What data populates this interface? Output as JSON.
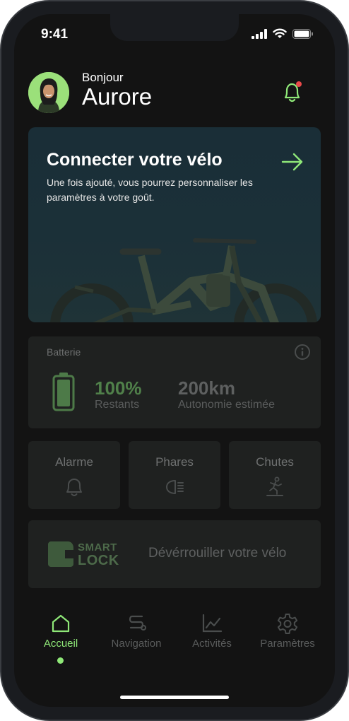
{
  "status_bar": {
    "time": "9:41"
  },
  "header": {
    "greeting": "Bonjour",
    "username": "Aurore"
  },
  "connect_card": {
    "title": "Connecter votre vélo",
    "description": "Une fois ajouté, vous pourrez personnaliser les paramètres à votre goût."
  },
  "battery": {
    "label": "Batterie",
    "percent_value": "100%",
    "percent_label": "Restants",
    "range_value": "200km",
    "range_label": "Autonomie estimée",
    "level": 1.0
  },
  "tiles": [
    {
      "label": "Alarme",
      "icon": "bell-icon"
    },
    {
      "label": "Phares",
      "icon": "headlight-icon"
    },
    {
      "label": "Chutes",
      "icon": "fall-icon"
    }
  ],
  "smart_lock": {
    "logo_line1": "SMART",
    "logo_line2": "LOCK",
    "action": "Dévérrouiller votre vélo"
  },
  "bottom_nav": [
    {
      "label": "Accueil",
      "icon": "home-icon",
      "active": true
    },
    {
      "label": "Navigation",
      "icon": "route-icon",
      "active": false
    },
    {
      "label": "Activités",
      "icon": "chart-icon",
      "active": false
    },
    {
      "label": "Paramètres",
      "icon": "gear-icon",
      "active": false
    }
  ],
  "colors": {
    "accent": "#8fe878",
    "notification": "#e8494a",
    "background": "#131313",
    "card": "#1f2120"
  }
}
